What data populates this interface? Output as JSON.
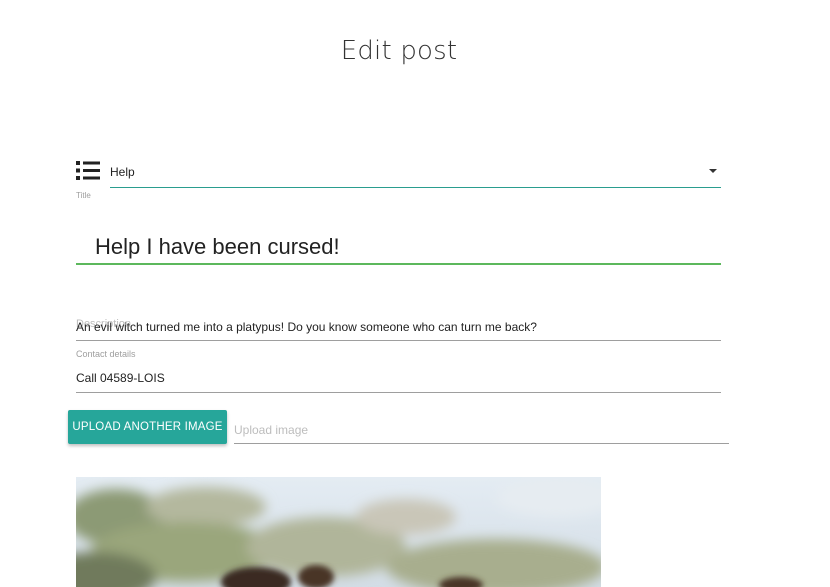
{
  "page": {
    "title": "Edit post"
  },
  "category": {
    "icon": "list-icon",
    "selected": "Help",
    "caption": "Title"
  },
  "title_field": {
    "value": "Help I have been cursed!"
  },
  "description": {
    "label": "Description",
    "value": "An evil witch turned me into a platypus! Do you know someone who can turn me back?"
  },
  "contact": {
    "label": "Contact details",
    "value": "Call 04589-LOIS"
  },
  "upload": {
    "button_label": "UPLOAD ANOTHER IMAGE",
    "placeholder": "Upload image"
  },
  "colors": {
    "accent": "#26a69a",
    "title_underline": "#5cb85c",
    "select_underline": "#2a9d8f"
  }
}
